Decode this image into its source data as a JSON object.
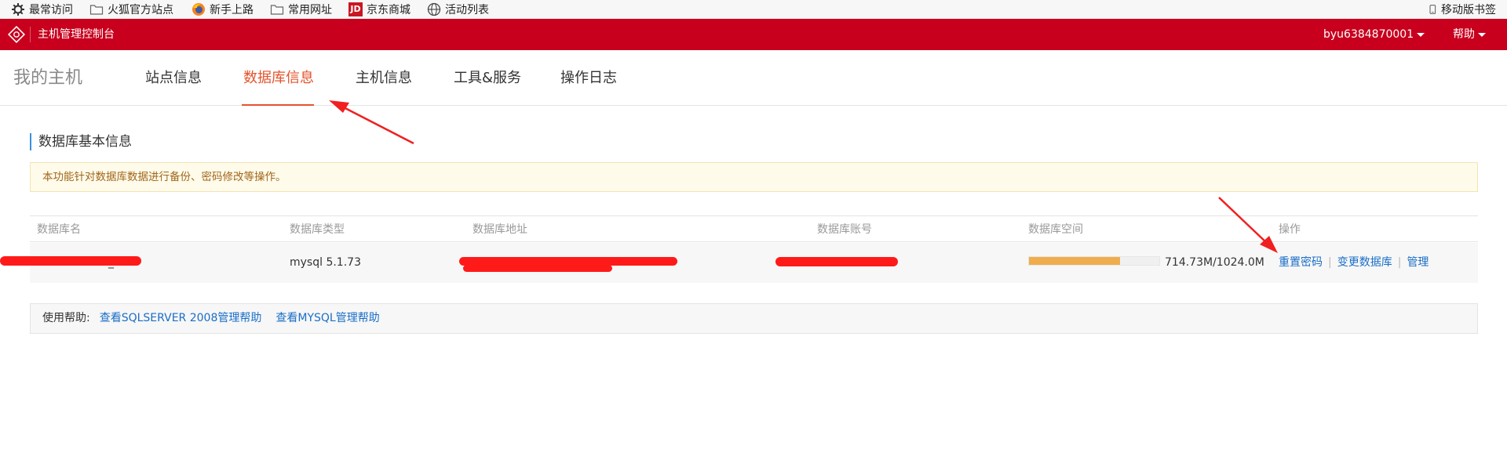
{
  "bookmarks": {
    "items": [
      {
        "label": "最常访问",
        "icon": "gear-icon"
      },
      {
        "label": "火狐官方站点",
        "icon": "folder-icon"
      },
      {
        "label": "新手上路",
        "icon": "firefox-icon"
      },
      {
        "label": "常用网址",
        "icon": "folder-icon"
      },
      {
        "label": "京东商城",
        "icon": "jd-icon",
        "icon_text": "JD"
      },
      {
        "label": "活动列表",
        "icon": "globe-icon"
      }
    ],
    "mobile": "移动版书签"
  },
  "header": {
    "title": "主机管理控制台",
    "user": "byu6384870001",
    "help": "帮助",
    "brand_color": "#c8001e"
  },
  "nav": {
    "home": "我的主机",
    "tabs": [
      "站点信息",
      "数据库信息",
      "主机信息",
      "工具&服务",
      "操作日志"
    ],
    "active_tab": "数据库信息",
    "active_color": "#e4532c"
  },
  "section": {
    "title": "数据库基本信息",
    "notice": "本功能针对数据库数据进行备份、密码修改等操作。"
  },
  "table": {
    "headers": [
      "数据库名",
      "数据库类型",
      "数据库地址",
      "数据库账号",
      "数据库空间",
      "操作"
    ],
    "row": {
      "name_visible": "_db",
      "type": "mysql 5.1.73",
      "space_used_fraction": 0.698,
      "space_text": "714.73M/1024.0M",
      "actions": [
        "重置密码",
        "变更数据库",
        "管理"
      ]
    }
  },
  "help": {
    "label": "使用帮助:",
    "links": [
      "查看SQLSERVER 2008管理帮助",
      "查看MYSQL管理帮助"
    ]
  }
}
